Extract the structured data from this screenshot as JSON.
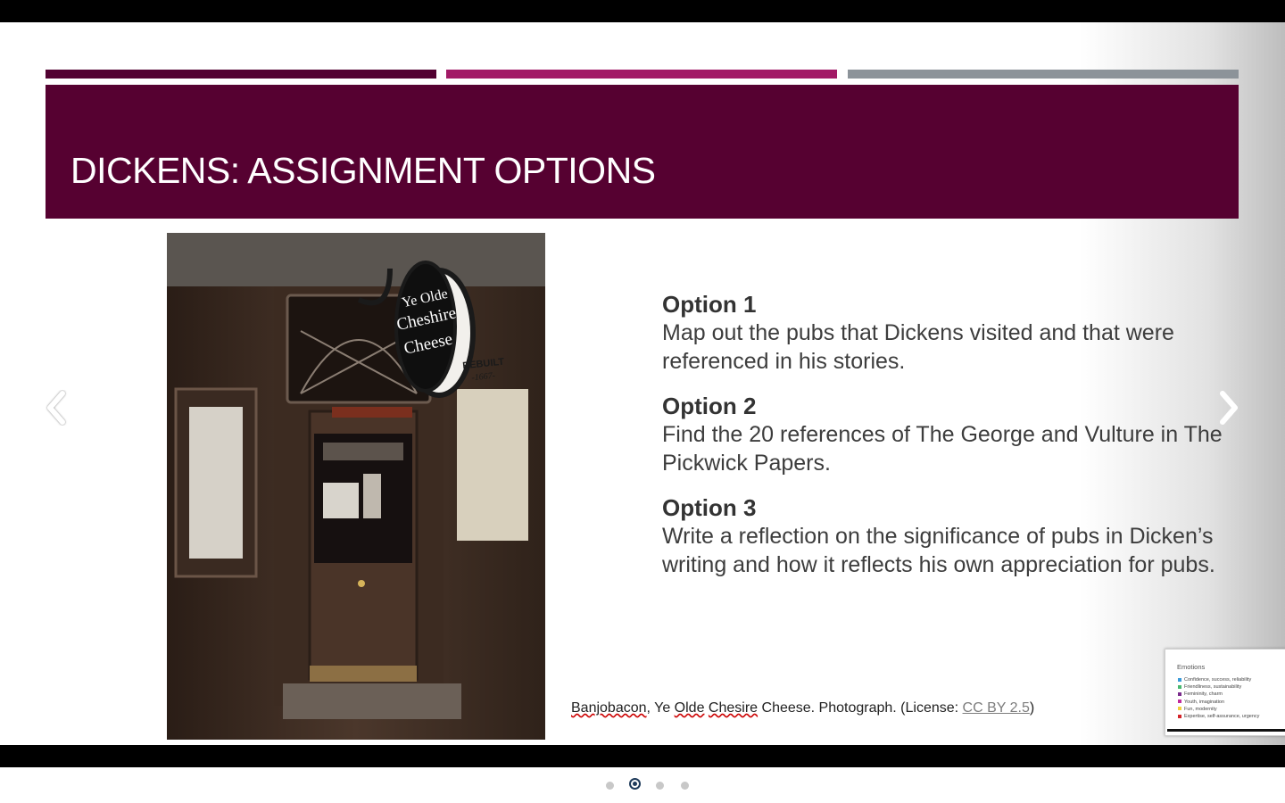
{
  "slide": {
    "title": "DICKENS: ASSIGNMENT OPTIONS",
    "options": [
      {
        "heading": "Option 1",
        "text": "Map out the pubs that Dickens visited and that were referenced in his stories."
      },
      {
        "heading": "Option 2",
        "text": "Find the 20 references of The George and Vulture in The Pickwick Papers."
      },
      {
        "heading": "Option 3",
        "text": "Write a reflection on the significance of pubs in Dicken’s writing and how it reflects his own appreciation for pubs."
      }
    ],
    "caption": {
      "author": "Banjobacon",
      "sep": ", ",
      "w1": "Ye ",
      "w2": "Olde",
      "w3": " ",
      "w4": "Chesire",
      "rest": " Cheese. Photograph. (License: ",
      "license": "CC BY 2.5",
      "close": ")"
    },
    "photo_sign": {
      "line1": "Ye Olde",
      "line2": "Cheshire",
      "line3": "Cheese",
      "rebuilt": "REBUILT",
      "year": "-1667-"
    }
  },
  "thumbnail": {
    "title": "Emotions",
    "items": [
      {
        "label": "Confidence, success, reliability",
        "color": "#3a9ad9"
      },
      {
        "label": "Friendliness, sustainability",
        "color": "#48b86f"
      },
      {
        "label": "Femininity, charm",
        "color": "#7a2c8c"
      },
      {
        "label": "Youth, imagination",
        "color": "#c12a9c"
      },
      {
        "label": "Fun, modernity",
        "color": "#f2d03c"
      },
      {
        "label": "Expertise, self-assurance, urgency",
        "color": "#d4242a"
      }
    ]
  },
  "navigation": {
    "prev_icon": "chevron-left-icon",
    "next_icon": "chevron-right-icon",
    "page_count": 4,
    "current_page": 2
  },
  "colors": {
    "header": "#560131",
    "stripe1": "#520131",
    "stripe2": "#a21a66",
    "stripe3": "#8c9399"
  }
}
